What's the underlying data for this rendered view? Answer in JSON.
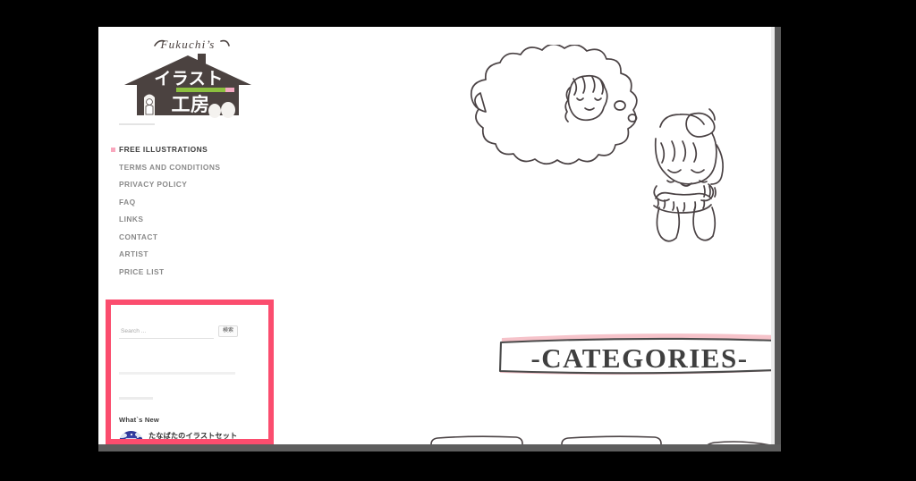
{
  "window": {
    "background_color": "#000000",
    "page_background": "#ffffff",
    "scrollbar_color": "#5e5e5e"
  },
  "sidebar": {
    "logo": {
      "script_text": "Fukuchi's",
      "house_text_line1": "イラスト",
      "house_text_line2": "工房",
      "house_color": "#4b4240",
      "accent_green": "#8cbf3f",
      "accent_pink": "#f3a8c0",
      "icon_name": "site-logo"
    },
    "nav": {
      "items": [
        {
          "label": "FREE ILLUSTRATIONS",
          "current": true
        },
        {
          "label": "TERMS AND CONDITIONS",
          "current": false
        },
        {
          "label": "PRIVACY POLICY",
          "current": false
        },
        {
          "label": "FAQ",
          "current": false
        },
        {
          "label": "LINKS",
          "current": false
        },
        {
          "label": "CONTACT",
          "current": false
        },
        {
          "label": "ARTIST",
          "current": false
        },
        {
          "label": "PRICE LIST",
          "current": false
        }
      ],
      "marker_color": "#f9a7bd"
    },
    "search": {
      "placeholder": "Search ...",
      "value": "",
      "button_label": "検索"
    },
    "whats_new": {
      "heading": "What`s New",
      "items": [
        {
          "title": "たなばたのイラストセット",
          "date": "",
          "thumb_name": "tanabata-thumbnail"
        }
      ]
    },
    "highlight": {
      "color": "#fb4d6e",
      "description": "search-and-whats-new-highlight"
    }
  },
  "main": {
    "hero": {
      "alt": "girl daydreaming with thought bubble",
      "icon_name": "hero-illustration"
    },
    "categories_banner": {
      "label": "-CATEGORIES-",
      "highlight_color": "#f6c3ca",
      "ink_color": "#4a4a4a"
    },
    "category_cards": [
      {
        "label": ""
      },
      {
        "label": ""
      },
      {
        "label": ""
      }
    ]
  }
}
